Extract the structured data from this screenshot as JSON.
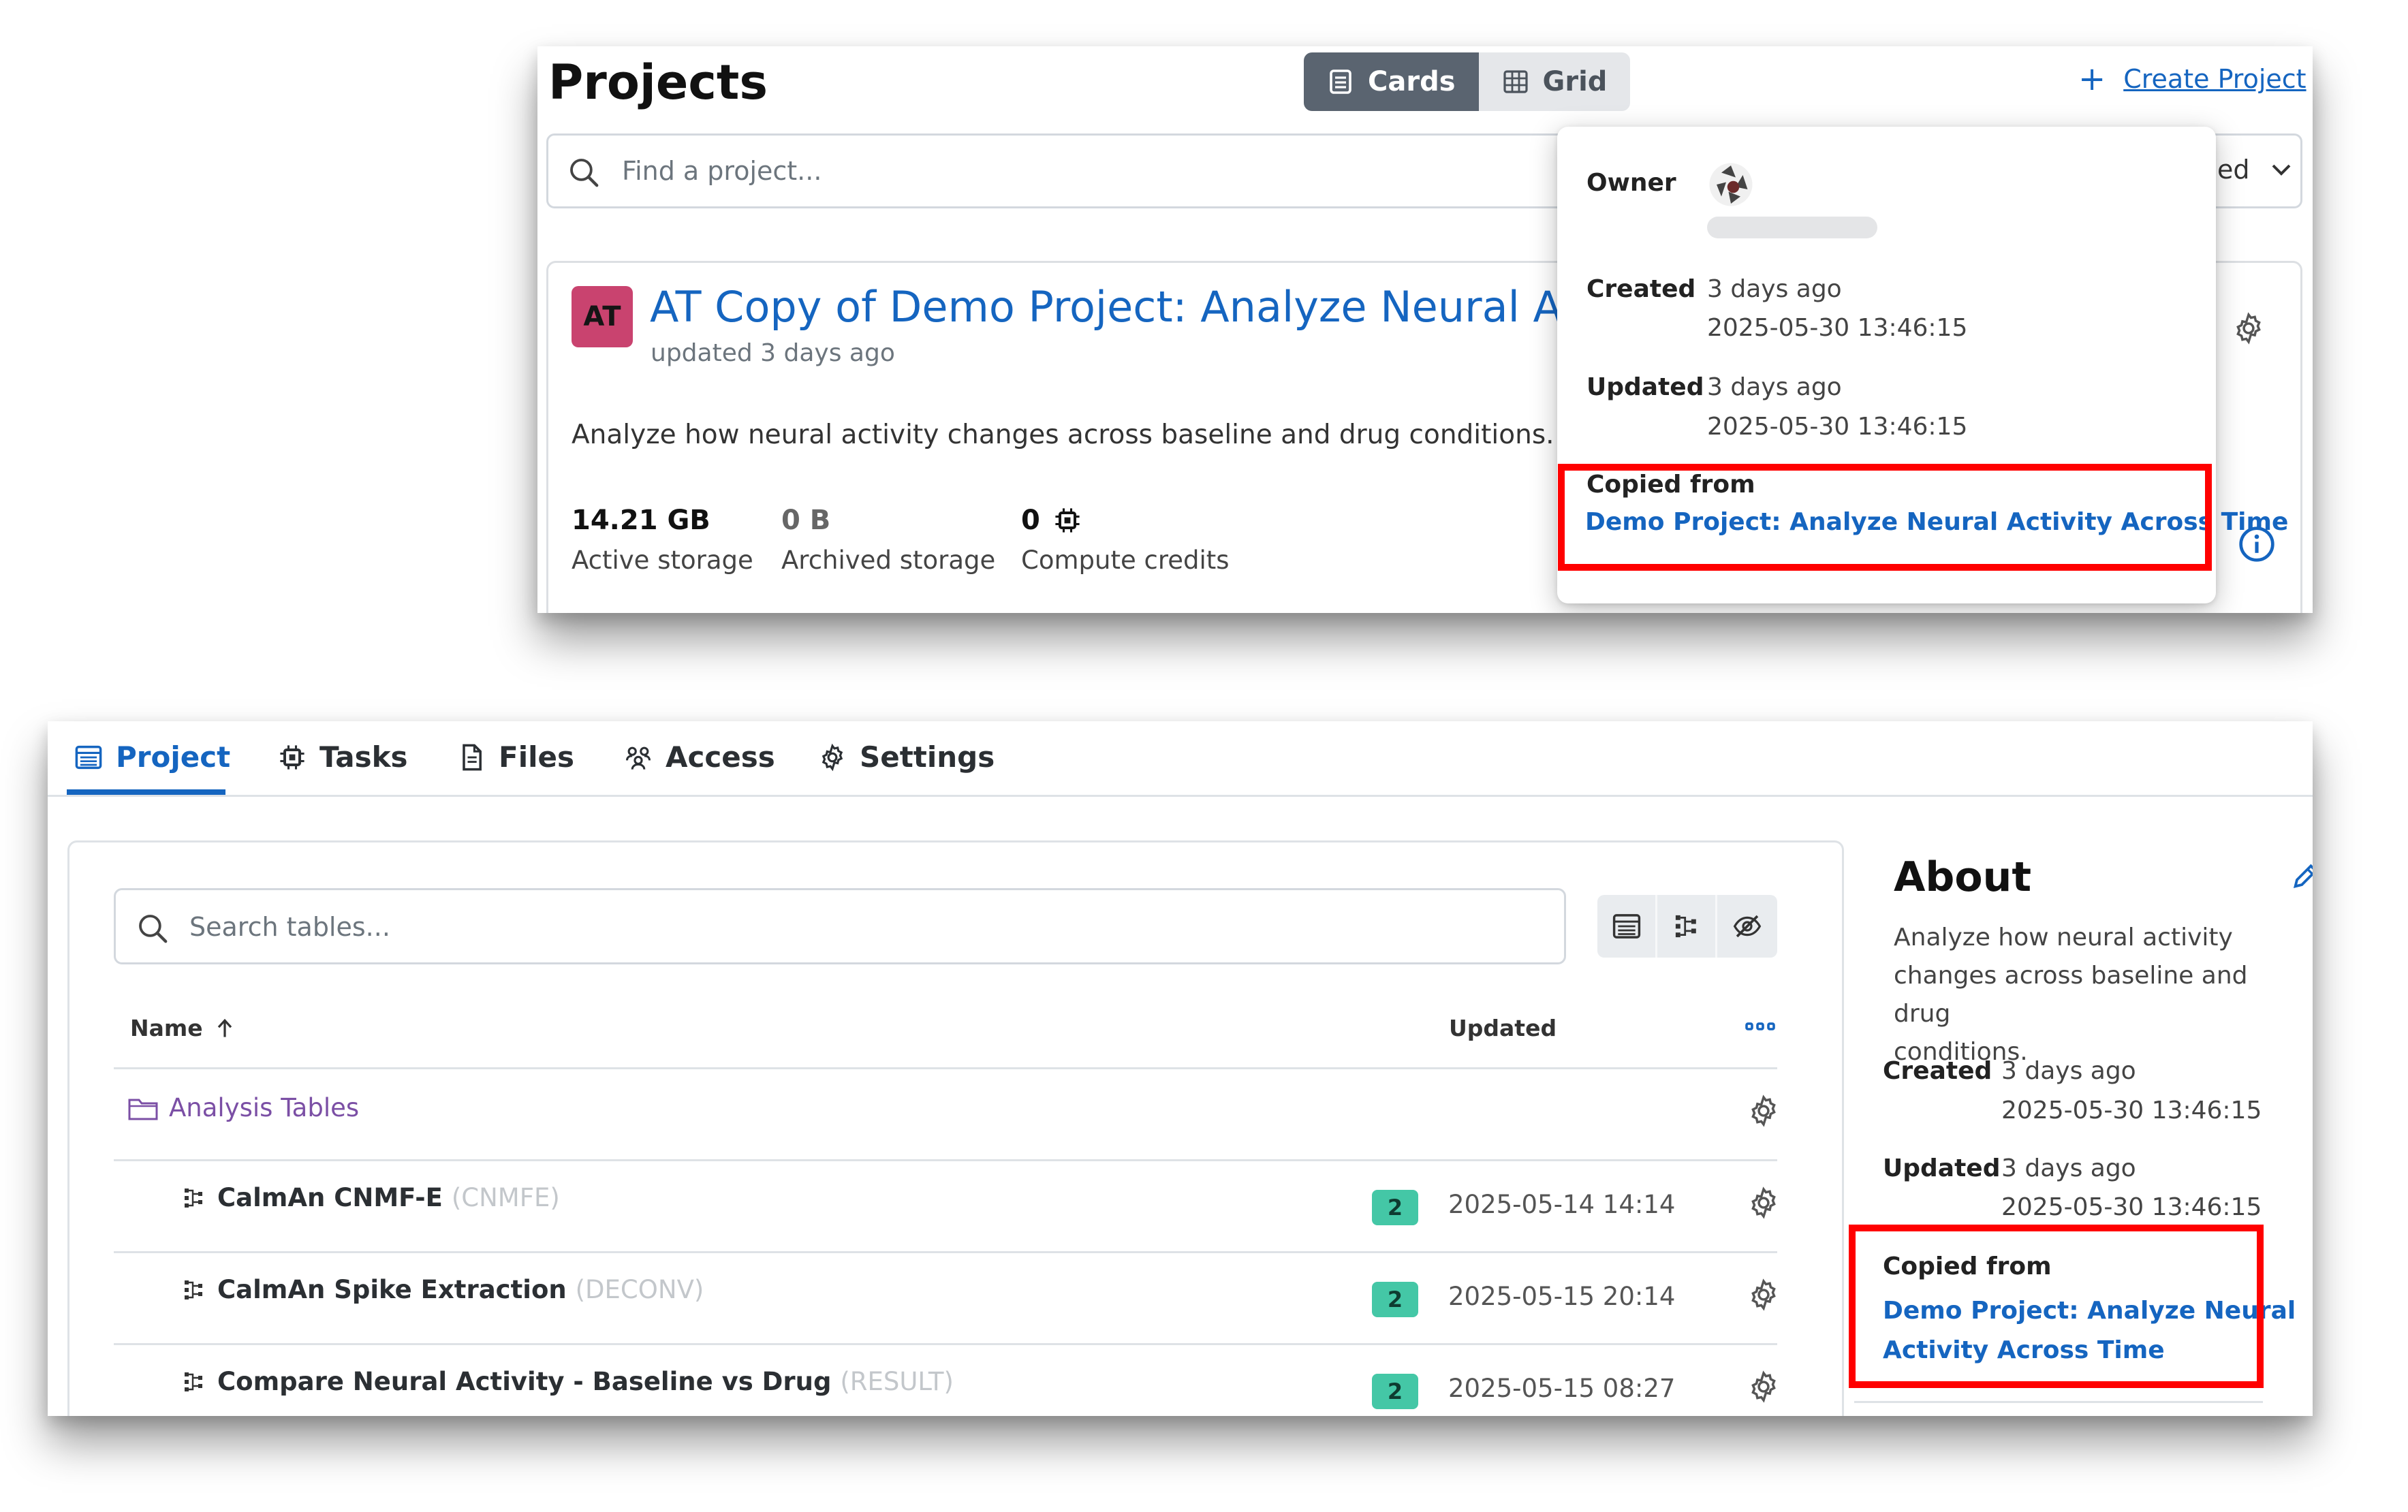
{
  "projects_page": {
    "title": "Projects",
    "view_toggle": {
      "cards_label": "Cards",
      "grid_label": "Grid",
      "selected": "Cards"
    },
    "create_project_label": "Create Project",
    "search_placeholder": "Find a project...",
    "sort_select_partial": "ed",
    "project_card": {
      "avatar_initials": "AT",
      "title": "AT Copy of Demo Project: Analyze Neural Ac",
      "updated_text": "updated 3 days ago",
      "description": "Analyze how neural activity changes across baseline and drug conditions.",
      "stats": [
        {
          "value": "14.21 GB",
          "label": "Active storage"
        },
        {
          "value": "0 B",
          "label": "Archived storage"
        },
        {
          "value": "0",
          "label": "Compute credits"
        }
      ]
    },
    "info_popover": {
      "owner_label": "Owner",
      "created_label": "Created",
      "created_relative": "3 days ago",
      "created_timestamp": "2025-05-30 13:46:15",
      "updated_label": "Updated",
      "updated_relative": "3 days ago",
      "updated_timestamp": "2025-05-30 13:46:15",
      "copied_from_label": "Copied from",
      "copied_from_link": "Demo Project: Analyze Neural Activity Across Time"
    }
  },
  "project_detail": {
    "tabs": [
      {
        "label": "Project",
        "icon": "table-icon",
        "active": true
      },
      {
        "label": "Tasks",
        "icon": "chip-icon",
        "active": false
      },
      {
        "label": "Files",
        "icon": "file-icon",
        "active": false
      },
      {
        "label": "Access",
        "icon": "people-icon",
        "active": false
      },
      {
        "label": "Settings",
        "icon": "gear-icon",
        "active": false
      }
    ],
    "table_search_placeholder": "Search tables...",
    "columns": {
      "name": "Name",
      "updated": "Updated"
    },
    "folder": {
      "name": "Analysis Tables"
    },
    "rows": [
      {
        "name": "CalmAn CNMF-E",
        "tag": "(CNMFE)",
        "badge": "2",
        "updated": "2025-05-14 14:14"
      },
      {
        "name": "CalmAn Spike Extraction",
        "tag": "(DECONV)",
        "badge": "2",
        "updated": "2025-05-15 20:14"
      },
      {
        "name": "Compare Neural Activity - Baseline vs Drug",
        "tag": "(RESULT)",
        "badge": "2",
        "updated": "2025-05-15 08:27"
      }
    ],
    "about": {
      "title": "About",
      "description_lines": [
        "Analyze how neural activity",
        "changes across baseline and drug",
        "conditions."
      ],
      "created_label": "Created",
      "created_relative": "3 days ago",
      "created_timestamp": "2025-05-30 13:46:15",
      "updated_label": "Updated",
      "updated_relative": "3 days ago",
      "updated_timestamp": "2025-05-30 13:46:15",
      "copied_from_label": "Copied from",
      "copied_from_lines": [
        "Demo Project: Analyze Neural",
        "Activity Across Time"
      ]
    }
  },
  "colors": {
    "accent_blue": "#1565c0",
    "highlight_red": "#ff0000",
    "avatar_pink": "#c9436f",
    "badge_teal": "#44c7a6",
    "folder_purple": "#7b4fa5"
  }
}
